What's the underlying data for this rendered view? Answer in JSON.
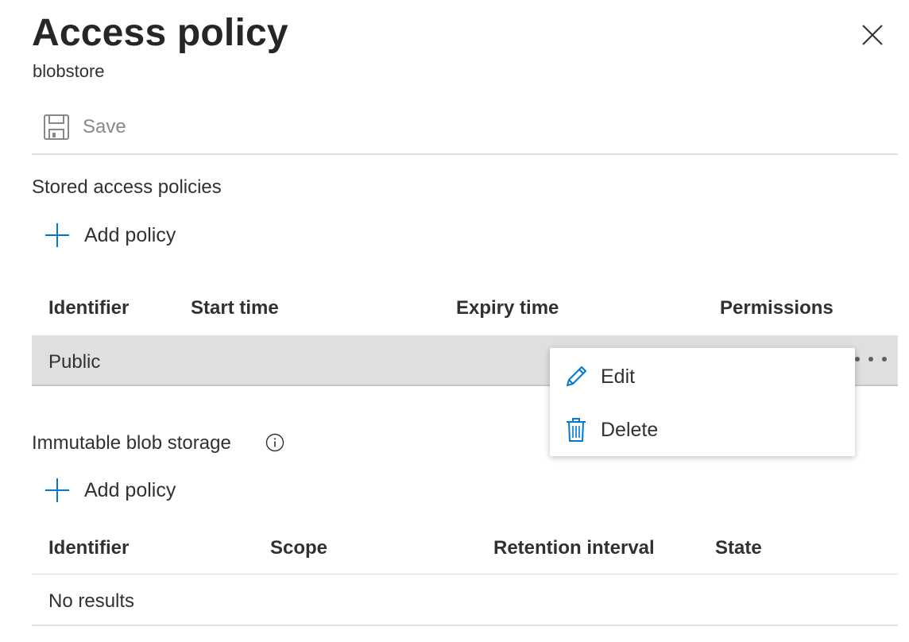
{
  "panel": {
    "title": "Access policy",
    "subtitle": "blobstore",
    "accent_color": "#0078d4"
  },
  "toolbar": {
    "save_label": "Save"
  },
  "stored": {
    "section_label": "Stored access policies",
    "add_label": "Add policy",
    "columns": [
      "Identifier",
      "Start time",
      "Expiry time",
      "Permissions"
    ],
    "rows": [
      {
        "identifier": "Public",
        "start_time": "",
        "expiry_time": "",
        "permissions": ""
      }
    ]
  },
  "context_menu": {
    "items": [
      {
        "label": "Edit",
        "icon": "pencil-icon"
      },
      {
        "label": "Delete",
        "icon": "trash-icon"
      }
    ]
  },
  "immutable": {
    "section_label": "Immutable blob storage",
    "add_label": "Add policy",
    "columns": [
      "Identifier",
      "Scope",
      "Retention interval",
      "State"
    ],
    "empty_text": "No results"
  }
}
